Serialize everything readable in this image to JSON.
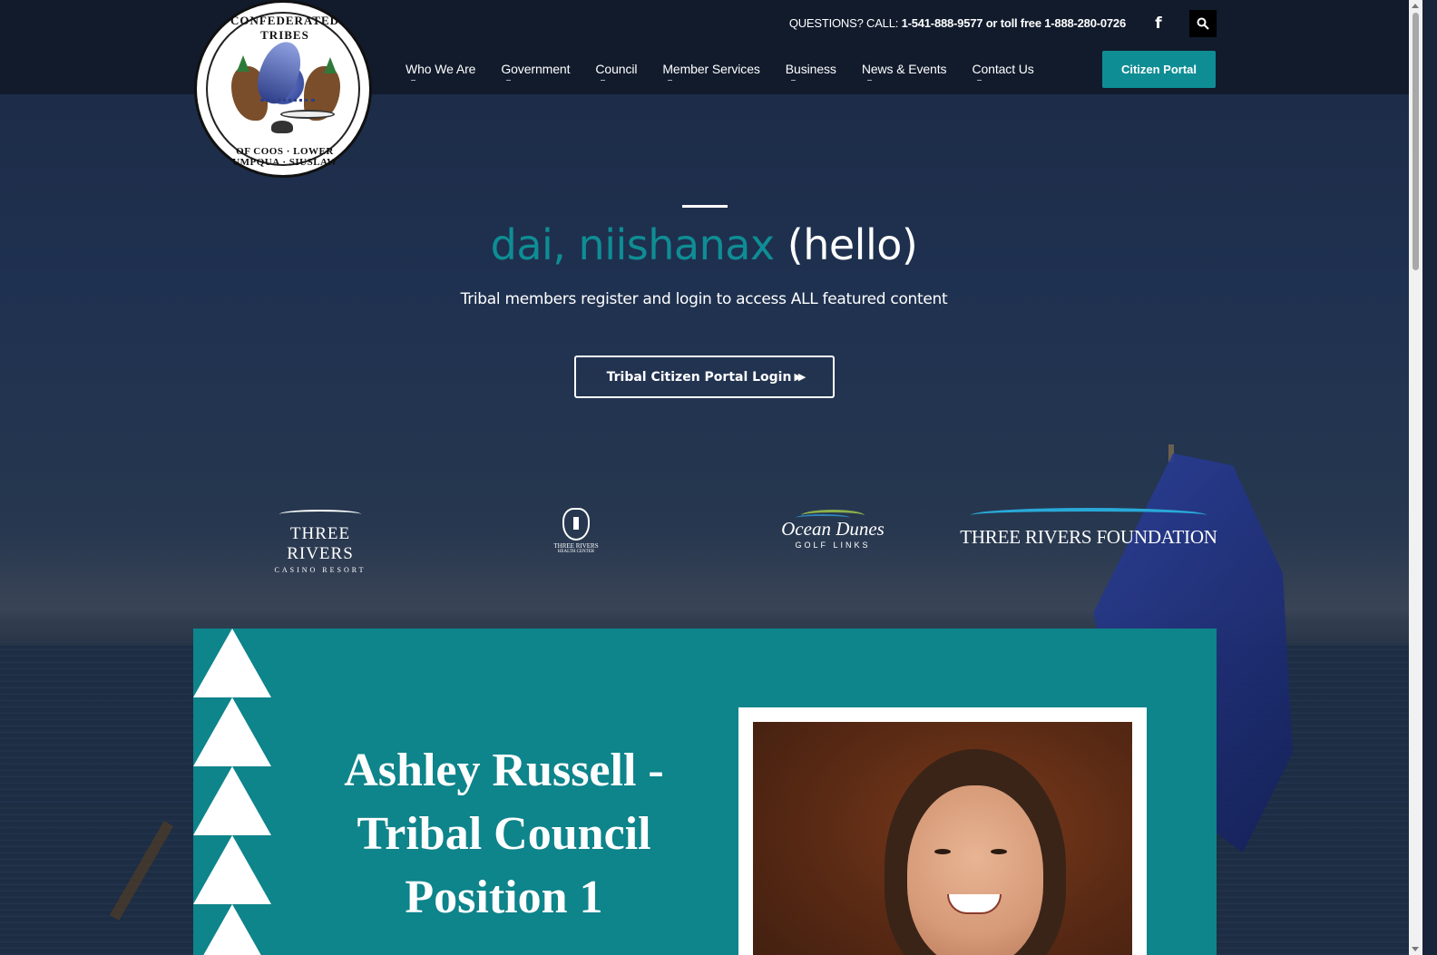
{
  "header": {
    "logo_text_top": "CONFEDERATED TRIBES",
    "logo_text_bottom": "OF COOS · LOWER UMPQUA · SIUSLAW",
    "contact_prefix": "QUESTIONS? CALL: ",
    "contact_phone": "1-541-888-9577 or toll free 1-888-280-0726",
    "facebook_glyph": "f",
    "search_icon": "search-icon",
    "nav": [
      {
        "label": "Who We Are"
      },
      {
        "label": "Government"
      },
      {
        "label": "Council"
      },
      {
        "label": "Member Services"
      },
      {
        "label": "Business"
      },
      {
        "label": "News & Events"
      },
      {
        "label": "Contact Us"
      }
    ],
    "portal_button": "Citizen Portal"
  },
  "hero": {
    "title_native": "dai, niishanax",
    "title_translation": " (hello)",
    "subtitle": "Tribal members register and login to access ALL featured content",
    "login_button": "Tribal Citizen Portal Login",
    "login_arrows": "▶▶"
  },
  "partners": [
    {
      "name": "THREE RIVERS",
      "sub": "CASINO RESORT"
    },
    {
      "name": "THREE RIVERS",
      "sub": "HEALTH CENTER"
    },
    {
      "name": "Ocean Dunes",
      "sub": "GOLF LINKS"
    },
    {
      "name": "THREE RIVERS FOUNDATION"
    }
  ],
  "feature": {
    "title": "Ashley Russell - Tribal Council Position 1"
  },
  "colors": {
    "teal": "#0f8d94",
    "header_bg": "#111b2c",
    "card_bg": "#0e848b"
  }
}
